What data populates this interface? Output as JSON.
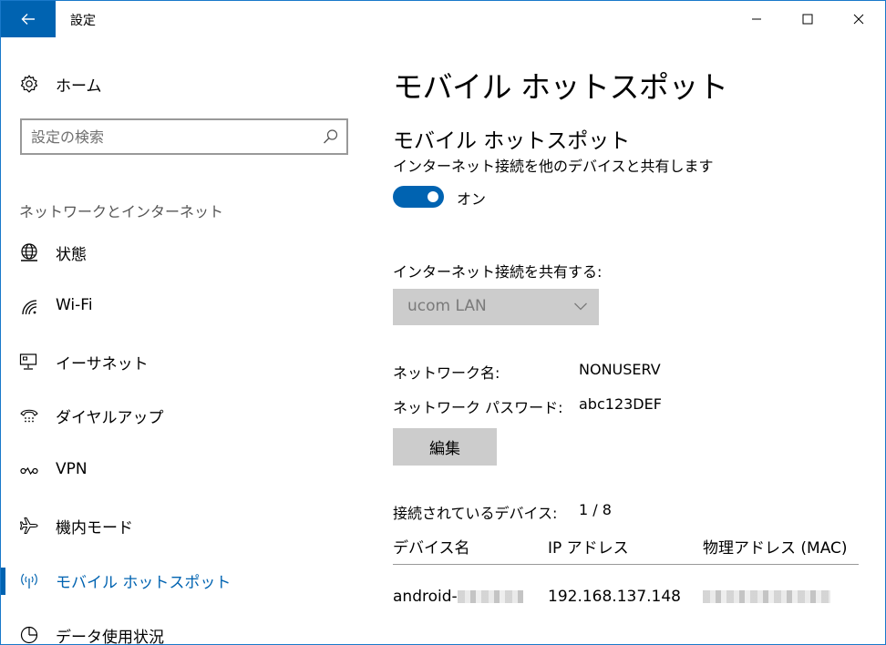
{
  "window": {
    "title": "設定"
  },
  "sidebar": {
    "home_label": "ホーム",
    "search_placeholder": "設定の検索",
    "section_title": "ネットワークとインターネット",
    "items": [
      {
        "label": "状態",
        "icon": "globe-icon"
      },
      {
        "label": "Wi-Fi",
        "icon": "wifi-icon"
      },
      {
        "label": "イーサネット",
        "icon": "ethernet-icon"
      },
      {
        "label": "ダイヤルアップ",
        "icon": "dialup-icon"
      },
      {
        "label": "VPN",
        "icon": "vpn-icon"
      },
      {
        "label": "機内モード",
        "icon": "airplane-icon"
      },
      {
        "label": "モバイル ホットスポット",
        "icon": "hotspot-icon",
        "active": true
      },
      {
        "label": "データ使用状況",
        "icon": "data-usage-icon"
      }
    ]
  },
  "main": {
    "page_title": "モバイル ホットスポット",
    "section_title": "モバイル ホットスポット",
    "section_desc": "インターネット接続を他のデバイスと共有します",
    "toggle_state": "オン",
    "share_label": "インターネット接続を共有する:",
    "share_value": "ucom LAN",
    "network_name_label": "ネットワーク名:",
    "network_name_value": "NONUSERV",
    "password_label": "ネットワーク パスワード:",
    "password_value": "abc123DEF",
    "edit_label": "編集",
    "connected_label": "接続されているデバイス:",
    "connected_value": "1 / 8",
    "table": {
      "headers": [
        "デバイス名",
        "IP アドレス",
        "物理アドレス (MAC)"
      ],
      "rows": [
        {
          "device": "android-",
          "ip": "192.168.137.148"
        }
      ]
    }
  },
  "colors": {
    "accent": "#0063b1",
    "window_border": "#1979ca",
    "disabled_bg": "#cccccc"
  }
}
